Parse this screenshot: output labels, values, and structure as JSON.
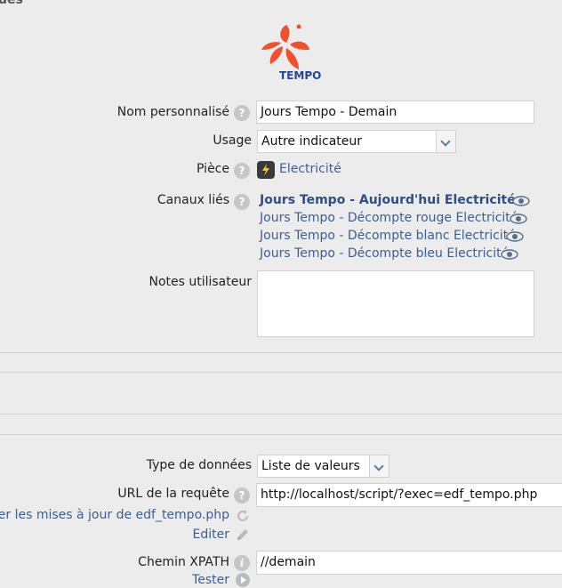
{
  "top_cut_label": "ues",
  "logo": {
    "text": "TEMPO",
    "icon": "edf-logo-icon",
    "accent": "#f0502b",
    "text_color": "#20489a"
  },
  "form": {
    "name": {
      "label": "Nom personnalisé",
      "value": "Jours Tempo - Demain"
    },
    "usage": {
      "label": "Usage",
      "value": "Autre indicateur"
    },
    "room": {
      "label": "Pièce",
      "value": "Electricité",
      "icon": "lightning-icon"
    },
    "channels": {
      "label": "Canaux liés",
      "items": [
        "Jours Tempo - Aujourd'hui Electricité",
        "Jours Tempo - Décompte rouge Electricité",
        "Jours Tempo - Décompte blanc Electricité",
        "Jours Tempo - Décompte bleu Electricité"
      ]
    },
    "notes": {
      "label": "Notes utilisateur",
      "value": ""
    },
    "data_type": {
      "label": "Type de données",
      "value": "Liste de valeurs"
    },
    "url": {
      "label": "URL de la requête",
      "value": "http://localhost/script/?exec=edf_tempo.php",
      "verify_link": "ifier les mises à jour de edf_tempo.php",
      "edit_link": "Editer"
    },
    "xpath": {
      "label": "Chemin XPATH",
      "value": "//demain",
      "test_link": "Tester"
    }
  },
  "colors": {
    "link": "#3a5f95",
    "help_icon": "#c4c6c8",
    "background": "#ececec"
  }
}
